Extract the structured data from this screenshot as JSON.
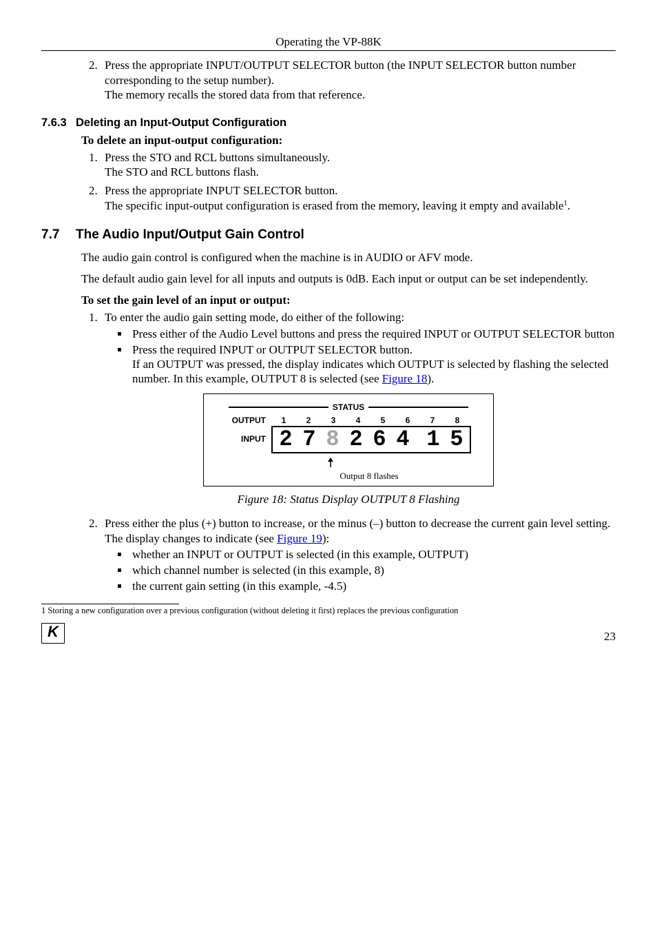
{
  "header": {
    "running": "Operating the VP-88K"
  },
  "step2_top": {
    "num": "2.",
    "line1": "Press the appropriate INPUT/OUTPUT SELECTOR button (the INPUT SELECTOR button number corresponding to the setup number).",
    "line2": "The memory recalls the stored data from that reference."
  },
  "sec763": {
    "num": "7.6.3",
    "title": "Deleting an Input-Output Configuration",
    "lead": "To delete an input-output configuration:",
    "s1a": "Press the STO and RCL buttons simultaneously.",
    "s1b": "The STO and RCL buttons flash.",
    "s2a": "Press the appropriate INPUT SELECTOR button.",
    "s2b_pre": "The specific input-output configuration is erased from the memory, leaving it empty and available",
    "s2b_post": "."
  },
  "sec77": {
    "num": "7.7",
    "title": "The Audio Input/Output Gain Control",
    "p1": "The audio gain control is configured when the machine is in AUDIO or AFV mode.",
    "p2": "The default audio gain level for all inputs and outputs is 0dB. Each input or output can be set independently.",
    "lead": "To set the gain level of an input or output:",
    "s1": "To enter the audio gain setting mode, do either of the following:",
    "s1b1": "Press either of the Audio Level buttons and press the required INPUT or OUTPUT SELECTOR button",
    "s1b2a": "Press the required INPUT or OUTPUT SELECTOR button.",
    "s1b2b_pre": "If an OUTPUT was pressed, the display indicates which OUTPUT is selected by flashing the selected number. In this example, OUTPUT 8 is selected (see ",
    "s1b2b_link": "Figure 18",
    "s1b2b_post": ").",
    "s2a": "Press either the plus (+) button to increase, or the minus (–) button to decrease the current gain level setting.",
    "s2b_pre": "The display changes to indicate (see ",
    "s2b_link": "Figure 19",
    "s2b_post": "):",
    "s2l1": "whether an INPUT or OUTPUT is selected (in this example, OUTPUT)",
    "s2l2": "which channel number is selected (in this example, 8)",
    "s2l3": "the current gain setting (in this example, -4.5)"
  },
  "figure18": {
    "status_label": "STATUS",
    "output_label": "OUTPUT",
    "input_label": "INPUT",
    "cols": [
      "1",
      "2",
      "3",
      "4",
      "5",
      "6",
      "7",
      "8"
    ],
    "digits": [
      "2",
      "7",
      "8",
      "2",
      "6",
      "4",
      "1",
      "5"
    ],
    "arrow_label": "Output 8 flashes",
    "caption": "Figure 18: Status Display OUTPUT 8 Flashing"
  },
  "footnote": {
    "marker": "1",
    "text": " Storing a new configuration over a previous configuration (without deleting it first) replaces the previous configuration"
  },
  "footer": {
    "page": "23",
    "logo_letter": "K"
  }
}
